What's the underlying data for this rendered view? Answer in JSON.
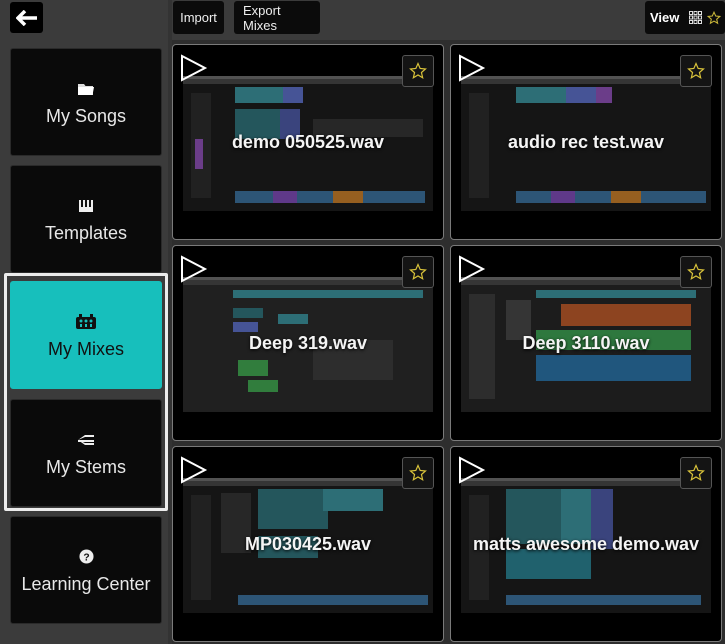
{
  "sidebar": {
    "items": [
      {
        "label": "My Songs",
        "icon": "folder-icon",
        "active": false
      },
      {
        "label": "Templates",
        "icon": "keyboard-icon",
        "active": false
      },
      {
        "label": "My Mixes",
        "icon": "mixer-icon",
        "active": true
      },
      {
        "label": "My Stems",
        "icon": "stems-icon",
        "active": false
      },
      {
        "label": "Learning Center",
        "icon": "help-circle-icon",
        "active": false
      }
    ]
  },
  "toolbar": {
    "import_label": "Import",
    "export_label": "Export Mixes",
    "view_label": "View"
  },
  "mixes": [
    {
      "title": "demo 050525.wav"
    },
    {
      "title": "audio rec test.wav"
    },
    {
      "title": "Deep 319.wav"
    },
    {
      "title": "Deep 3110.wav"
    },
    {
      "title": "MP030425.wav"
    },
    {
      "title": "matts awesome demo.wav"
    }
  ],
  "colors": {
    "accent": "#17bfbc",
    "star": "#d8c23a",
    "active_frame": "#ececec"
  }
}
